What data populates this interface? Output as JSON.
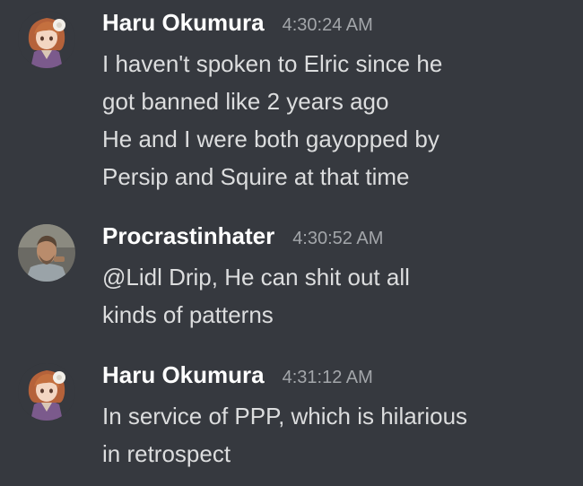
{
  "colors": {
    "background": "#36393f",
    "username": "#ffffff",
    "timestamp": "#a3a6aa",
    "text": "#dcddde"
  },
  "messages": [
    {
      "author": "Haru Okumura",
      "avatar_icon": "anime-character-avatar-icon",
      "timestamp": "4:30:24 AM",
      "lines": [
        "I haven't spoken to Elric since he",
        "got banned like 2 years ago",
        "He and I were both gayopped by",
        "Persip and Squire at that time"
      ]
    },
    {
      "author": "Procrastinhater",
      "avatar_icon": "man-photo-avatar-icon",
      "timestamp": "4:30:52 AM",
      "lines": [
        "@Lidl Drip, He can shit out all",
        "kinds of patterns"
      ]
    },
    {
      "author": "Haru Okumura",
      "avatar_icon": "anime-character-avatar-icon",
      "timestamp": "4:31:12 AM",
      "lines": [
        "In service of PPP, which is hilarious",
        "in retrospect"
      ]
    }
  ]
}
